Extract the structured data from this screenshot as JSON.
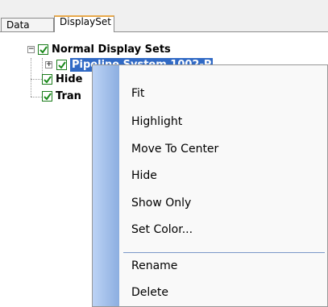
{
  "tabs": [
    {
      "label": "Data",
      "active": false
    },
    {
      "label": "DisplaySet",
      "active": true
    }
  ],
  "tree": {
    "root": {
      "label": "Normal Display Sets",
      "checked": true,
      "expanded": true
    },
    "child": {
      "label": "Pipeline System 1002-P",
      "checked": true,
      "expanded": false,
      "selected": true
    },
    "siblings": [
      {
        "label": "Hide",
        "checked": true
      },
      {
        "label": "Tran",
        "checked": true
      }
    ]
  },
  "context_menu": {
    "items": [
      "Fit",
      "Highlight",
      "Move To Center",
      "Hide",
      "Show Only",
      "Set Color..."
    ],
    "items_after_separator": [
      "Rename",
      "Delete"
    ]
  },
  "colors": {
    "selection": "#316ac5",
    "check": "#1c7d1c",
    "menu_gutter": "#9dbbe8",
    "active_tab_accent": "#e8a84a"
  }
}
